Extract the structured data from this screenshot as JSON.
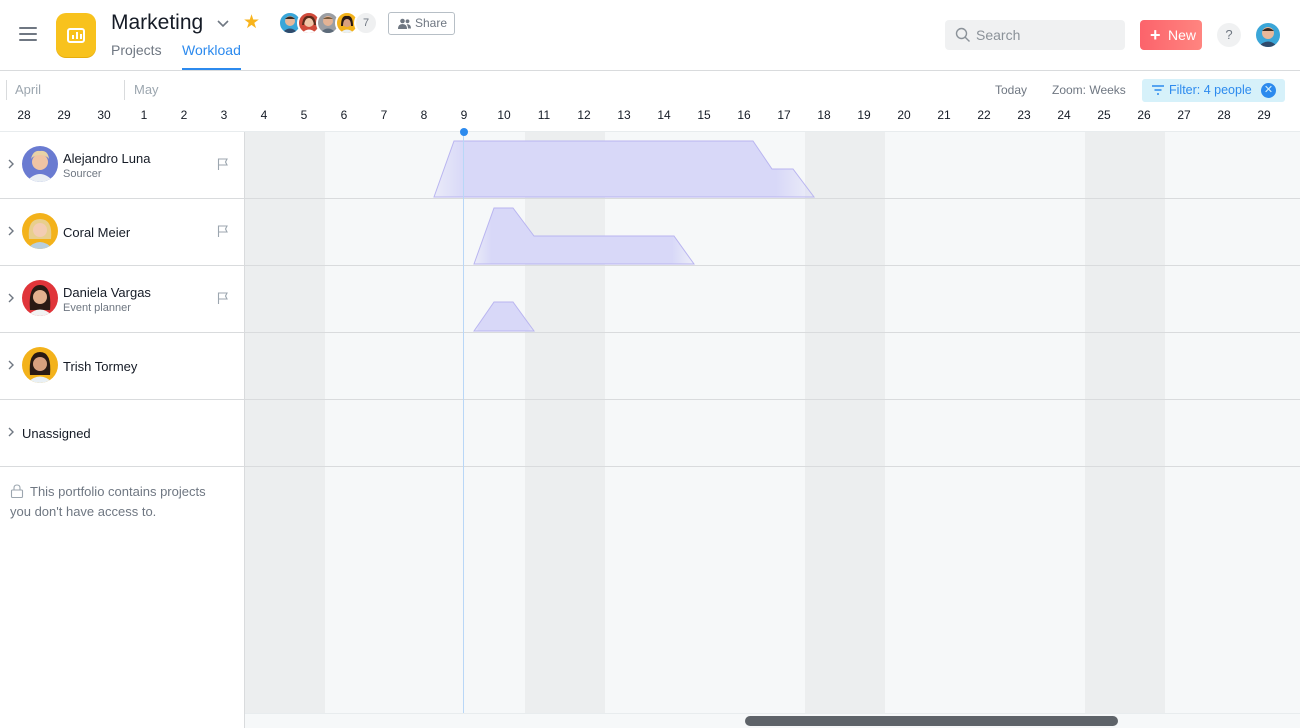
{
  "header": {
    "title": "Marketing",
    "tabs": [
      {
        "label": "Projects",
        "active": false
      },
      {
        "label": "Workload",
        "active": true
      }
    ],
    "member_count": "7",
    "share_label": "Share",
    "search_placeholder": "Search",
    "new_label": "New",
    "help_label": "?"
  },
  "toolbar": {
    "months": [
      "April",
      "May"
    ],
    "today_label": "Today",
    "zoom_label": "Zoom: Weeks",
    "filter_label": "Filter: 4 people"
  },
  "timeline": {
    "days": [
      "28",
      "29",
      "30",
      "1",
      "2",
      "3",
      "4",
      "5",
      "6",
      "7",
      "8",
      "9",
      "10",
      "11",
      "12",
      "13",
      "14",
      "15",
      "16",
      "17",
      "18",
      "19",
      "20",
      "21",
      "22",
      "23",
      "24",
      "25",
      "26",
      "27",
      "28",
      "29"
    ],
    "today": "9"
  },
  "people": [
    {
      "name": "Alejandro Luna",
      "role": "Sourcer",
      "avatar_color": "#6a7bd1",
      "flag": true
    },
    {
      "name": "Coral Meier",
      "role": "",
      "avatar_color": "#f3b21b",
      "flag": true
    },
    {
      "name": "Daniela Vargas",
      "role": "Event planner",
      "avatar_color": "#e0353a",
      "flag": true
    },
    {
      "name": "Trish Tormey",
      "role": "",
      "avatar_color": "#f3b21b",
      "flag": false
    }
  ],
  "unassigned_label": "Unassigned",
  "notice": "This portfolio contains projects you don't have access to.",
  "colors": {
    "accent": "#2c8aee",
    "new_button": "#fc636b",
    "workload_fill": "#d8d8f8",
    "workload_stroke": "#a9a3ef",
    "star": "#f8b41d",
    "app_icon": "#f8c21d"
  },
  "icons": [
    "menu-icon",
    "chart-icon",
    "chevron-down-icon",
    "star-icon",
    "people-icon",
    "search-icon",
    "plus-icon",
    "help-icon",
    "filter-icon",
    "close-icon",
    "chevron-right-icon",
    "flag-icon",
    "lock-icon"
  ]
}
